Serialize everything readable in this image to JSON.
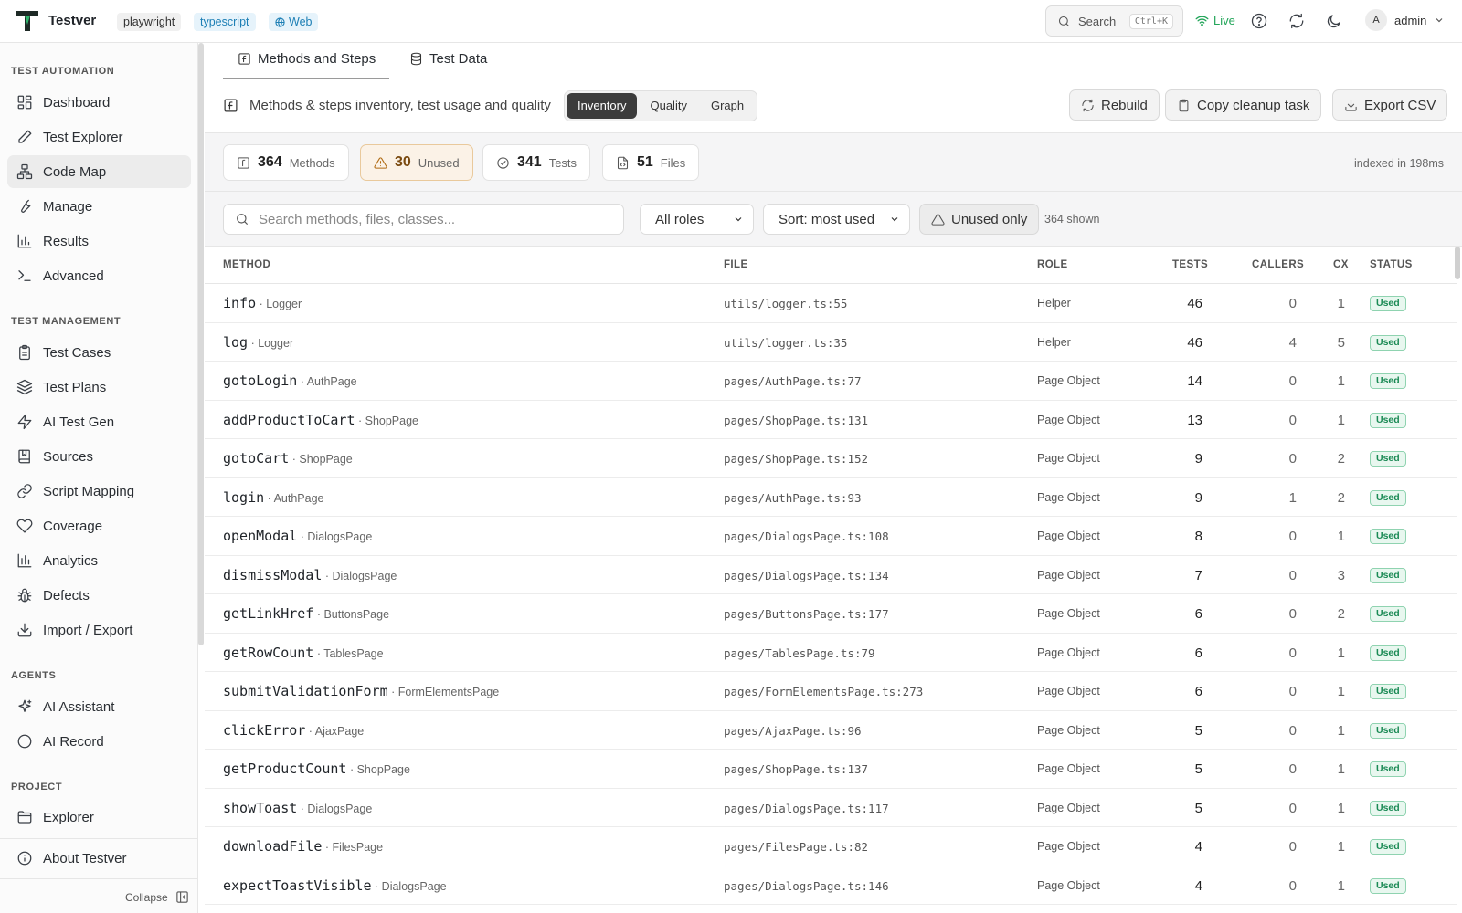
{
  "app": {
    "name": "Testver",
    "tags": [
      "playwright",
      "typescript",
      "Web"
    ],
    "search_label": "Search",
    "search_shortcut": "Ctrl+K",
    "live_label": "Live",
    "user_initial": "A",
    "user_name": "admin"
  },
  "sidebar": {
    "sections": {
      "automation": "TEST AUTOMATION",
      "management": "TEST MANAGEMENT",
      "agents": "AGENTS",
      "project": "PROJECT"
    },
    "automation_items": [
      {
        "label": "Dashboard",
        "icon": "dashboard-icon"
      },
      {
        "label": "Test Explorer",
        "icon": "pencil-icon"
      },
      {
        "label": "Code Map",
        "icon": "code-map-icon",
        "active": true
      },
      {
        "label": "Manage",
        "icon": "wrench-icon"
      },
      {
        "label": "Results",
        "icon": "bar-chart-icon"
      },
      {
        "label": "Advanced",
        "icon": "terminal-icon"
      }
    ],
    "management_items": [
      {
        "label": "Test Cases",
        "icon": "clipboard-icon"
      },
      {
        "label": "Test Plans",
        "icon": "layers-icon"
      },
      {
        "label": "AI Test Gen",
        "icon": "bolt-icon"
      },
      {
        "label": "Sources",
        "icon": "book-icon"
      },
      {
        "label": "Script Mapping",
        "icon": "link-icon"
      },
      {
        "label": "Coverage",
        "icon": "heart-icon"
      },
      {
        "label": "Analytics",
        "icon": "analytics-icon"
      },
      {
        "label": "Defects",
        "icon": "bug-icon"
      },
      {
        "label": "Import / Export",
        "icon": "download-icon"
      }
    ],
    "agent_items": [
      {
        "label": "AI Assistant",
        "icon": "sparkle-icon"
      },
      {
        "label": "AI Record",
        "icon": "record-icon"
      }
    ],
    "project_items": [
      {
        "label": "Explorer",
        "icon": "folder-icon"
      }
    ],
    "about": "About Testver",
    "collapse": "Collapse"
  },
  "main": {
    "tabs": [
      "Methods and Steps",
      "Test Data"
    ],
    "header_title": "Methods & steps inventory, test usage and quality",
    "views": [
      "Inventory",
      "Quality",
      "Graph"
    ],
    "active_view": "Inventory",
    "actions": {
      "rebuild": "Rebuild",
      "copy_cleanup": "Copy cleanup task",
      "export_csv": "Export CSV"
    },
    "stats": [
      {
        "value": "364",
        "label": "Methods"
      },
      {
        "value": "30",
        "label": "Unused"
      },
      {
        "value": "341",
        "label": "Tests"
      },
      {
        "value": "51",
        "label": "Files"
      }
    ],
    "indexed": "indexed in 198ms",
    "filters": {
      "search_placeholder": "Search methods, files, classes...",
      "role": "All roles",
      "sort": "Sort: most used",
      "unused_only": "Unused only",
      "shown": "364 shown"
    },
    "columns": [
      "METHOD",
      "FILE",
      "ROLE",
      "TESTS",
      "CALLERS",
      "CX",
      "STATUS"
    ],
    "rows": [
      {
        "method": "info",
        "cls": "Logger",
        "file": "utils/logger.ts:55",
        "role": "Helper",
        "tests": "46",
        "callers": "0",
        "cx": "1",
        "status": "Used"
      },
      {
        "method": "log",
        "cls": "Logger",
        "file": "utils/logger.ts:35",
        "role": "Helper",
        "tests": "46",
        "callers": "4",
        "cx": "5",
        "status": "Used"
      },
      {
        "method": "gotoLogin",
        "cls": "AuthPage",
        "file": "pages/AuthPage.ts:77",
        "role": "Page Object",
        "tests": "14",
        "callers": "0",
        "cx": "1",
        "status": "Used"
      },
      {
        "method": "addProductToCart",
        "cls": "ShopPage",
        "file": "pages/ShopPage.ts:131",
        "role": "Page Object",
        "tests": "13",
        "callers": "0",
        "cx": "1",
        "status": "Used"
      },
      {
        "method": "gotoCart",
        "cls": "ShopPage",
        "file": "pages/ShopPage.ts:152",
        "role": "Page Object",
        "tests": "9",
        "callers": "0",
        "cx": "2",
        "status": "Used"
      },
      {
        "method": "login",
        "cls": "AuthPage",
        "file": "pages/AuthPage.ts:93",
        "role": "Page Object",
        "tests": "9",
        "callers": "1",
        "cx": "2",
        "status": "Used"
      },
      {
        "method": "openModal",
        "cls": "DialogsPage",
        "file": "pages/DialogsPage.ts:108",
        "role": "Page Object",
        "tests": "8",
        "callers": "0",
        "cx": "1",
        "status": "Used"
      },
      {
        "method": "dismissModal",
        "cls": "DialogsPage",
        "file": "pages/DialogsPage.ts:134",
        "role": "Page Object",
        "tests": "7",
        "callers": "0",
        "cx": "3",
        "status": "Used"
      },
      {
        "method": "getLinkHref",
        "cls": "ButtonsPage",
        "file": "pages/ButtonsPage.ts:177",
        "role": "Page Object",
        "tests": "6",
        "callers": "0",
        "cx": "2",
        "status": "Used"
      },
      {
        "method": "getRowCount",
        "cls": "TablesPage",
        "file": "pages/TablesPage.ts:79",
        "role": "Page Object",
        "tests": "6",
        "callers": "0",
        "cx": "1",
        "status": "Used"
      },
      {
        "method": "submitValidationForm",
        "cls": "FormElementsPage",
        "file": "pages/FormElementsPage.ts:273",
        "role": "Page Object",
        "tests": "6",
        "callers": "0",
        "cx": "1",
        "status": "Used"
      },
      {
        "method": "clickError",
        "cls": "AjaxPage",
        "file": "pages/AjaxPage.ts:96",
        "role": "Page Object",
        "tests": "5",
        "callers": "0",
        "cx": "1",
        "status": "Used"
      },
      {
        "method": "getProductCount",
        "cls": "ShopPage",
        "file": "pages/ShopPage.ts:137",
        "role": "Page Object",
        "tests": "5",
        "callers": "0",
        "cx": "1",
        "status": "Used"
      },
      {
        "method": "showToast",
        "cls": "DialogsPage",
        "file": "pages/DialogsPage.ts:117",
        "role": "Page Object",
        "tests": "5",
        "callers": "0",
        "cx": "1",
        "status": "Used"
      },
      {
        "method": "downloadFile",
        "cls": "FilesPage",
        "file": "pages/FilesPage.ts:82",
        "role": "Page Object",
        "tests": "4",
        "callers": "0",
        "cx": "1",
        "status": "Used"
      },
      {
        "method": "expectToastVisible",
        "cls": "DialogsPage",
        "file": "pages/DialogsPage.ts:146",
        "role": "Page Object",
        "tests": "4",
        "callers": "0",
        "cx": "1",
        "status": "Used"
      }
    ]
  }
}
